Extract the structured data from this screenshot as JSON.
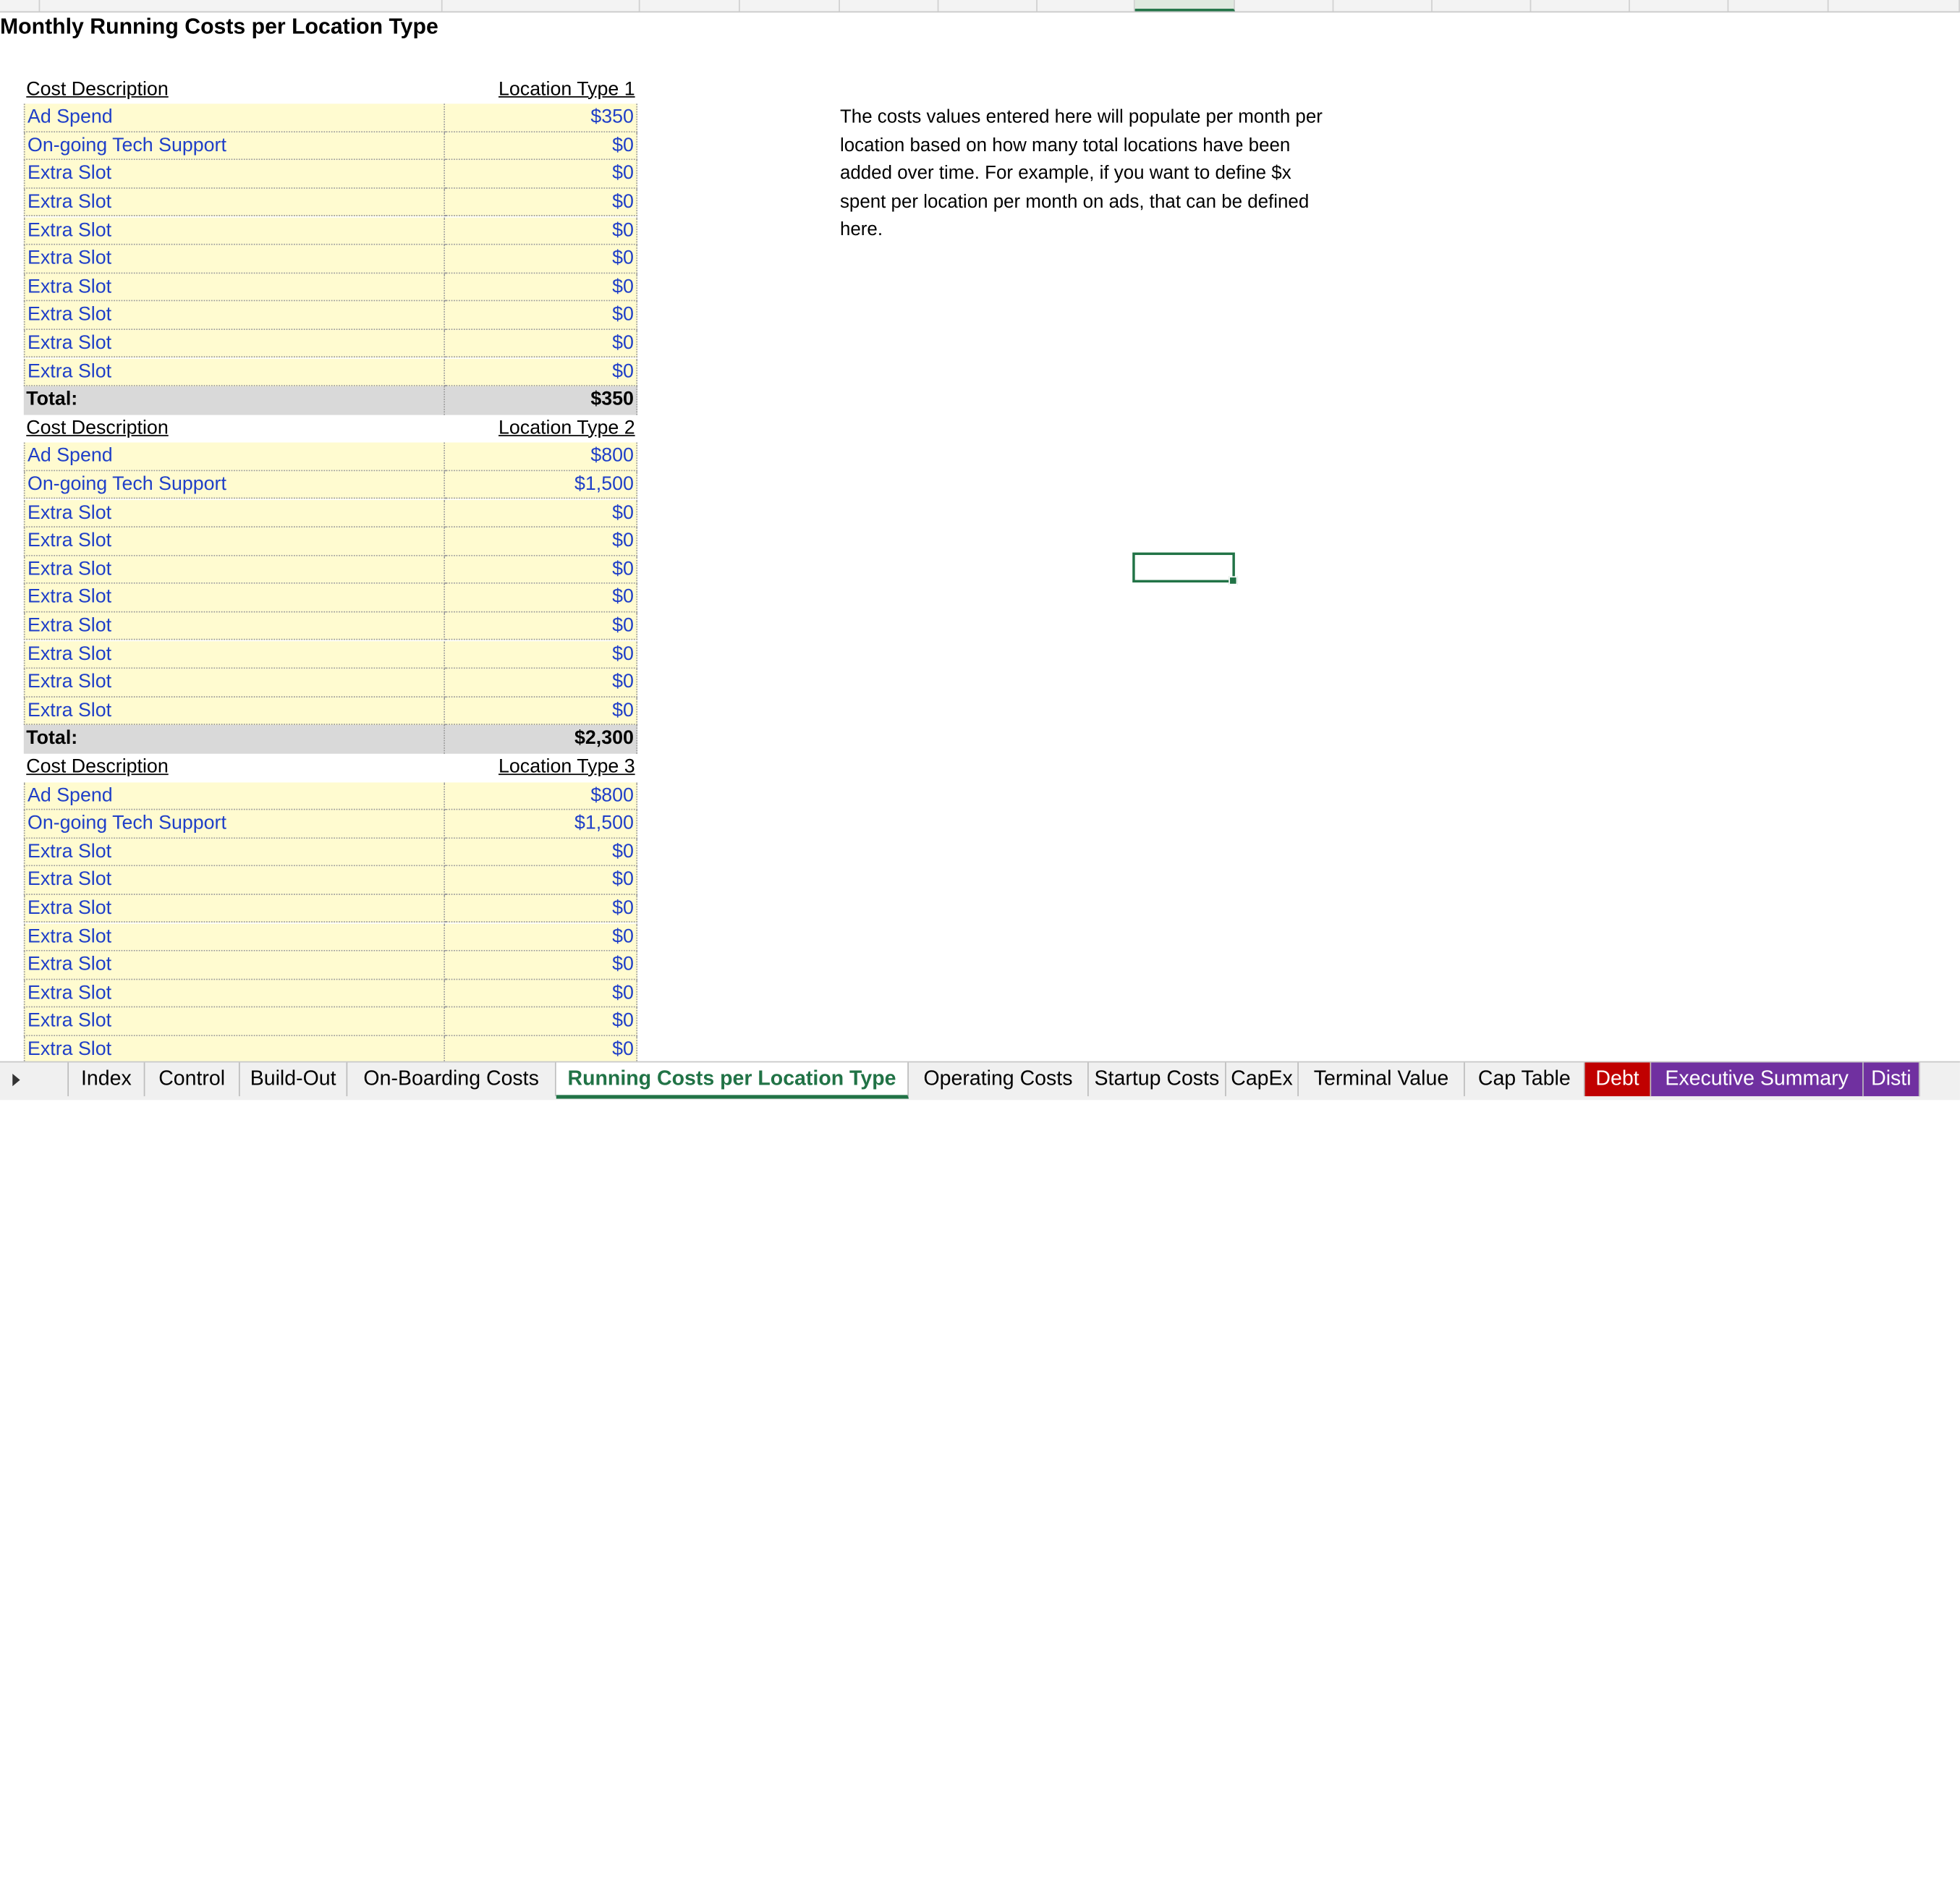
{
  "title": "Monthly Running Costs per Location Type",
  "note": "The costs values entered here will populate per month per location based on how many total locations have been added over time. For example, if you want to define $x spent per location per month on ads, that can be defined here.",
  "sections": [
    {
      "header_desc": "Cost Description",
      "header_loc": "Location Type 1",
      "items": [
        {
          "desc": "Ad Spend",
          "val": "$350"
        },
        {
          "desc": "On-going Tech Support",
          "val": "$0"
        },
        {
          "desc": "Extra Slot",
          "val": "$0"
        },
        {
          "desc": "Extra Slot",
          "val": "$0"
        },
        {
          "desc": "Extra Slot",
          "val": "$0"
        },
        {
          "desc": "Extra Slot",
          "val": "$0"
        },
        {
          "desc": "Extra Slot",
          "val": "$0"
        },
        {
          "desc": "Extra Slot",
          "val": "$0"
        },
        {
          "desc": "Extra Slot",
          "val": "$0"
        },
        {
          "desc": "Extra Slot",
          "val": "$0"
        }
      ],
      "total_label": "Total:",
      "total": "$350"
    },
    {
      "header_desc": "Cost Description",
      "header_loc": "Location Type 2",
      "items": [
        {
          "desc": "Ad Spend",
          "val": "$800"
        },
        {
          "desc": "On-going Tech Support",
          "val": "$1,500"
        },
        {
          "desc": "Extra Slot",
          "val": "$0"
        },
        {
          "desc": "Extra Slot",
          "val": "$0"
        },
        {
          "desc": "Extra Slot",
          "val": "$0"
        },
        {
          "desc": "Extra Slot",
          "val": "$0"
        },
        {
          "desc": "Extra Slot",
          "val": "$0"
        },
        {
          "desc": "Extra Slot",
          "val": "$0"
        },
        {
          "desc": "Extra Slot",
          "val": "$0"
        },
        {
          "desc": "Extra Slot",
          "val": "$0"
        }
      ],
      "total_label": "Total:",
      "total": "$2,300"
    },
    {
      "header_desc": "Cost Description",
      "header_loc": "Location Type 3",
      "items": [
        {
          "desc": "Ad Spend",
          "val": "$800"
        },
        {
          "desc": "On-going Tech Support",
          "val": "$1,500"
        },
        {
          "desc": "Extra Slot",
          "val": "$0"
        },
        {
          "desc": "Extra Slot",
          "val": "$0"
        },
        {
          "desc": "Extra Slot",
          "val": "$0"
        },
        {
          "desc": "Extra Slot",
          "val": "$0"
        },
        {
          "desc": "Extra Slot",
          "val": "$0"
        },
        {
          "desc": "Extra Slot",
          "val": "$0"
        },
        {
          "desc": "Extra Slot",
          "val": "$0"
        },
        {
          "desc": "Extra Slot",
          "val": "$0"
        }
      ]
    }
  ],
  "tabs": [
    {
      "label": "Index",
      "style": "normal"
    },
    {
      "label": "Control",
      "style": "normal"
    },
    {
      "label": "Build-Out",
      "style": "normal"
    },
    {
      "label": "On-Boarding Costs",
      "style": "normal"
    },
    {
      "label": "Running Costs per Location Type",
      "style": "active"
    },
    {
      "label": "Operating Costs",
      "style": "normal"
    },
    {
      "label": "Startup Costs",
      "style": "normal"
    },
    {
      "label": "CapEx",
      "style": "normal"
    },
    {
      "label": "Terminal Value",
      "style": "normal"
    },
    {
      "label": "Cap Table",
      "style": "normal"
    },
    {
      "label": "Debt",
      "style": "red"
    },
    {
      "label": "Executive Summary",
      "style": "purple"
    },
    {
      "label": "Disti",
      "style": "purple"
    }
  ],
  "colors": {
    "accent": "#217346",
    "input_fill": "#fffbd0",
    "input_text": "#1f3fc8",
    "total_fill": "#d9d9d9",
    "tab_red": "#c00000",
    "tab_purple": "#7030a0"
  }
}
